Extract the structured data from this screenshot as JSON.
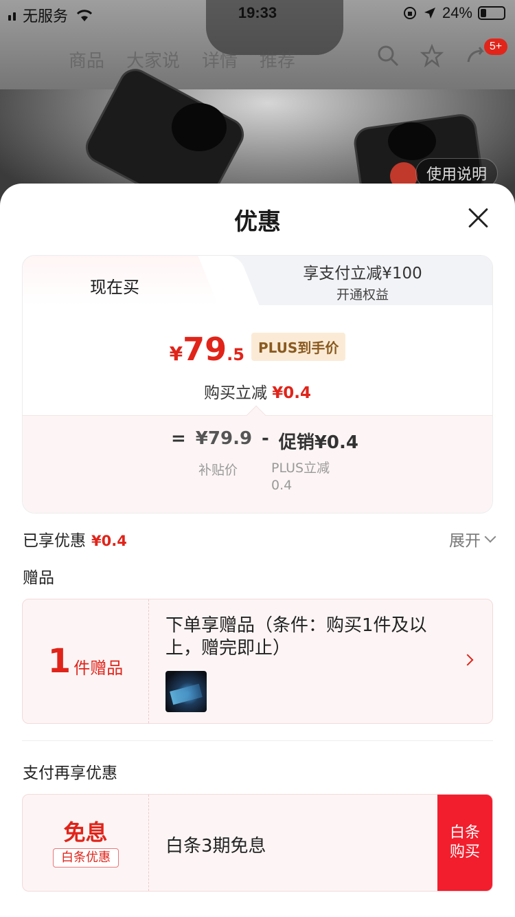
{
  "status_bar": {
    "carrier": "无服务",
    "time": "19:33",
    "battery": "24%"
  },
  "background_nav": {
    "tabs": [
      "商品",
      "大家说",
      "详情",
      "推荐"
    ],
    "message_badge": "5+",
    "manual_chip": "使用说明"
  },
  "sheet": {
    "title": "优惠",
    "tabs": {
      "buy_now": "现在买",
      "plus_line1": "享支付立减¥100",
      "plus_line2": "开通权益"
    },
    "price": {
      "currency": "¥",
      "integer": "79",
      "decimal": ".5",
      "plus_label": "PLUS到手价",
      "instant_cut_label": "购买立减",
      "instant_cut_value": "¥0.4"
    },
    "breakdown": {
      "equals": "=",
      "subsidy_price": "¥79.9",
      "minus": "-",
      "promo": "促销¥0.4",
      "subsidy_label": "补贴价",
      "plus_cut_label": "PLUS立减",
      "plus_cut_value": "0.4"
    },
    "enjoyed": {
      "label": "已享优惠",
      "value": "¥0.4",
      "expand_label": "展开"
    },
    "gifts": {
      "section_title": "赠品",
      "count": "1",
      "count_unit": "件赠品",
      "description": "下单享赠品（条件：购买1件及以上，赠完即止）"
    },
    "payment": {
      "section_title": "支付再享优惠",
      "big_label": "免息",
      "tag": "白条优惠",
      "description": "白条3期免息",
      "button_label": "白条购买"
    }
  },
  "colors": {
    "accent_red": "#e0241a",
    "button_red": "#f21e2d",
    "plus_gold_bg": "#fbebd6"
  }
}
